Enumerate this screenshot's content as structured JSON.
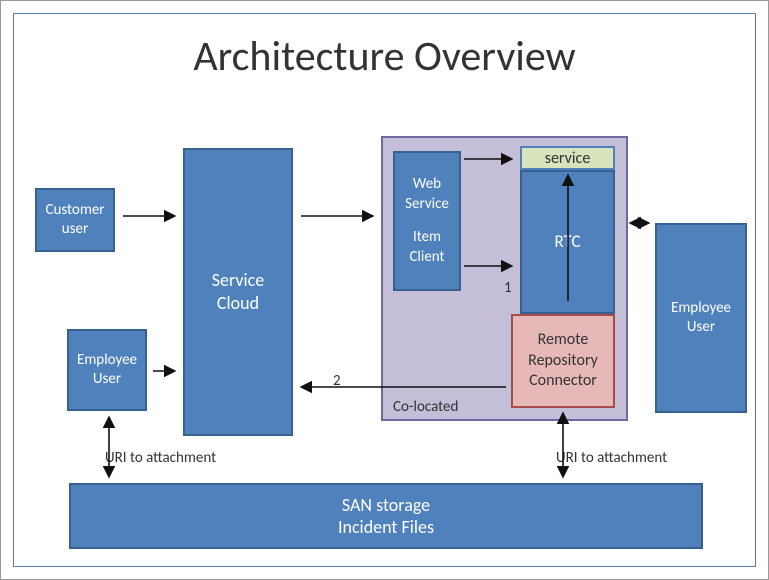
{
  "title": "Architecture Overview",
  "boxes": {
    "customer_user": "Customer user",
    "employee_user_left": "Employee User",
    "service_cloud": "Service Cloud",
    "web_service_line1": "Web Service",
    "web_service_line2": "Item Client",
    "service": "service",
    "rtc": "RTC",
    "remote_repo": "Remote Repository Connector",
    "employee_user_right": "Employee User",
    "san_line1": "SAN storage",
    "san_line2": "Incident Files"
  },
  "labels": {
    "colocated": "Co-located",
    "one": "1",
    "two": "2",
    "uri_left": "URI to attachment",
    "uri_right": "URI to attachment"
  }
}
